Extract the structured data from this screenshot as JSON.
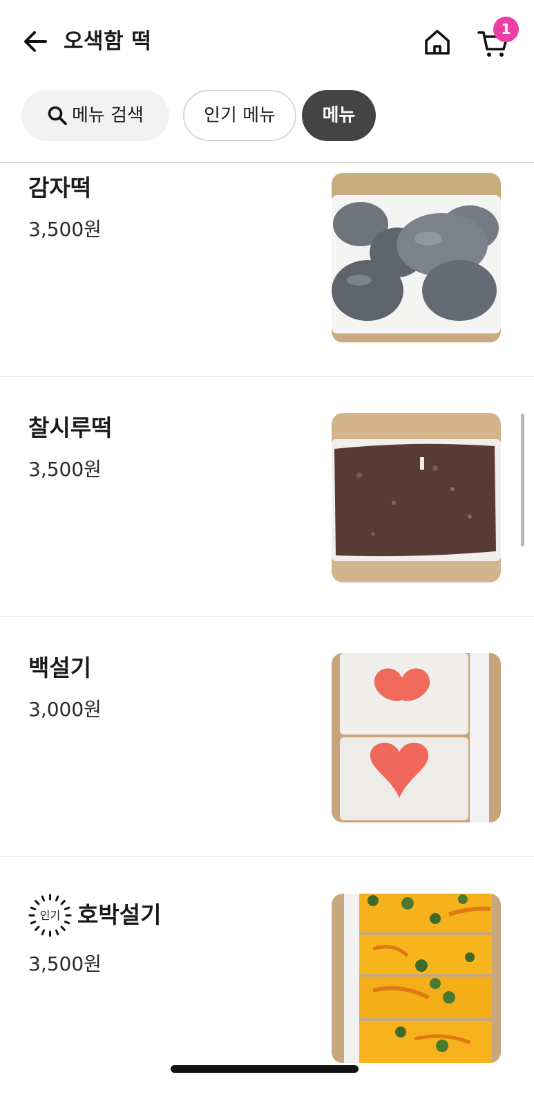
{
  "header": {
    "title": "오색함 떡",
    "cart_count": "1",
    "back_icon": "arrow-left-icon",
    "home_icon": "home-icon",
    "cart_icon": "cart-icon"
  },
  "filters": {
    "search_label": "메뉴 검색",
    "popular_label": "인기 메뉴",
    "menu_label": "메뉴",
    "active": "메뉴"
  },
  "items": [
    {
      "name": "감자떡",
      "price": "3,500원",
      "popular": false
    },
    {
      "name": "찰시루떡",
      "price": "3,500원",
      "popular": false
    },
    {
      "name": "백설기",
      "price": "3,000원",
      "popular": false
    },
    {
      "name": "호박설기",
      "price": "3,500원",
      "popular": true,
      "badge_text": "인기"
    }
  ],
  "colors": {
    "accent_badge": "#ec3fa6",
    "active_chip": "#444444"
  }
}
